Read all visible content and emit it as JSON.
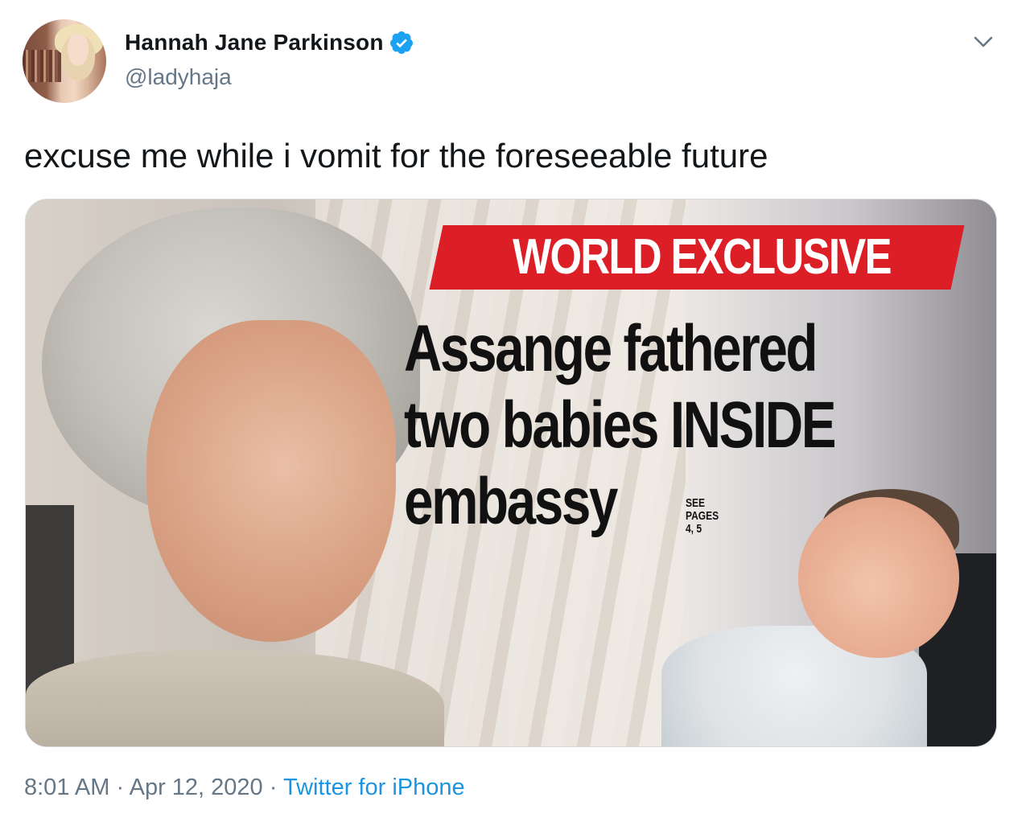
{
  "author": {
    "name": "Hannah Jane Parkinson",
    "handle": "@ladyhaja",
    "verified_icon": "verified-badge-icon"
  },
  "tweet": {
    "text": "excuse me while i vomit for the foreseeable future"
  },
  "media": {
    "banner": "WORLD EXCLUSIVE",
    "headline": [
      "Assange fathered",
      "two babies INSIDE",
      "embassy"
    ],
    "see_pages": [
      "SEE",
      "PAGES",
      "4, 5"
    ]
  },
  "footer": {
    "time": "8:01 AM",
    "separator": "·",
    "date": "Apr 12, 2020",
    "source": "Twitter for iPhone"
  },
  "colors": {
    "accent": "#1b95e0",
    "verified": "#1da1f2",
    "banner": "#dc1f26",
    "muted": "#657786"
  }
}
